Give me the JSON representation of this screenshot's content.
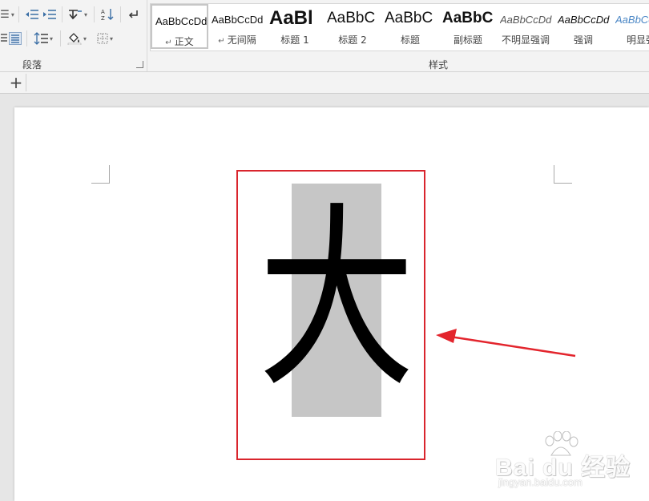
{
  "ribbon": {
    "paragraph_group_label": "段落",
    "styles_group_label": "样式",
    "styles": [
      {
        "preview": "AaBbCcDd",
        "name": "正文",
        "mark": "↵",
        "selected": true
      },
      {
        "preview": "AaBbCcDd",
        "name": "无间隔",
        "mark": "↵"
      },
      {
        "preview": "AaBl",
        "name": "标题 1"
      },
      {
        "preview": "AaBbC",
        "name": "标题 2"
      },
      {
        "preview": "AaBbC",
        "name": "标题"
      },
      {
        "preview": "AaBbC",
        "name": "副标题"
      },
      {
        "preview": "AaBbCcDd",
        "name": "不明显强调"
      },
      {
        "preview": "AaBbCcDd",
        "name": "强调"
      },
      {
        "preview": "AaBbCcDd",
        "name": "明显强"
      }
    ]
  },
  "tabbar": {
    "add_tab": "+"
  },
  "document": {
    "character": "大"
  },
  "watermark": {
    "brand": "Bai du 经验",
    "url": "jingyan.baidu.com"
  },
  "colors": {
    "highlight": "#d9252d",
    "char_background": "#c6c6c6"
  }
}
